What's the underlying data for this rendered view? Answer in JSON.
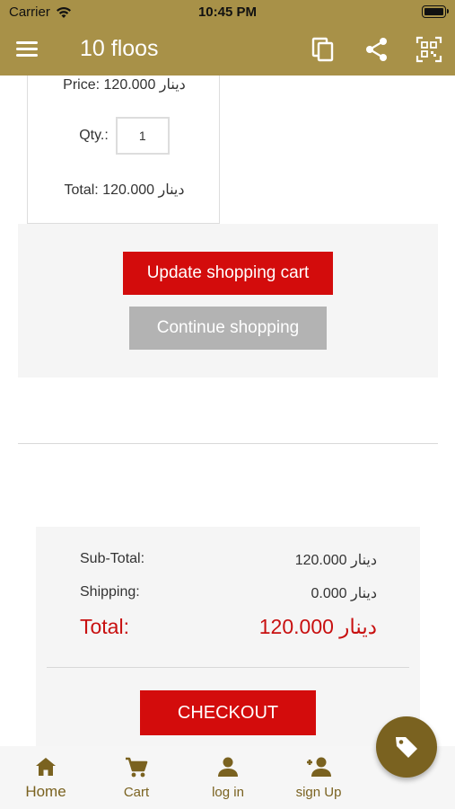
{
  "status_bar": {
    "carrier": "Carrier",
    "time": "10:45 PM"
  },
  "app_bar": {
    "title": "10 floos",
    "icons": [
      "menu-icon",
      "copy-icon",
      "share-icon",
      "qr-code-icon"
    ]
  },
  "product": {
    "price_text": "Price: 120.000 دينار",
    "qty_label": "Qty.:",
    "qty_value": "1",
    "total_text": "Total: 120.000 دينار"
  },
  "cart_actions": {
    "update_label": "Update shopping cart",
    "continue_label": "Continue shopping"
  },
  "totals": {
    "subtotal_label": "Sub-Total:",
    "subtotal_value": "120.000 دينار",
    "shipping_label": "Shipping:",
    "shipping_value": "0.000 دينار",
    "total_label": "Total:",
    "total_value": "120.000 دينار",
    "checkout_label": "CHECKOUT"
  },
  "bottom_nav": {
    "home": "Home",
    "cart": "Cart",
    "login": "log in",
    "signup": "sign Up"
  },
  "colors": {
    "header": "#a89148",
    "accent_red": "#d30c0c",
    "nav_brown": "#7a6220",
    "button_gray": "#b3b3b3"
  },
  "fab_icon": "tag-icon"
}
